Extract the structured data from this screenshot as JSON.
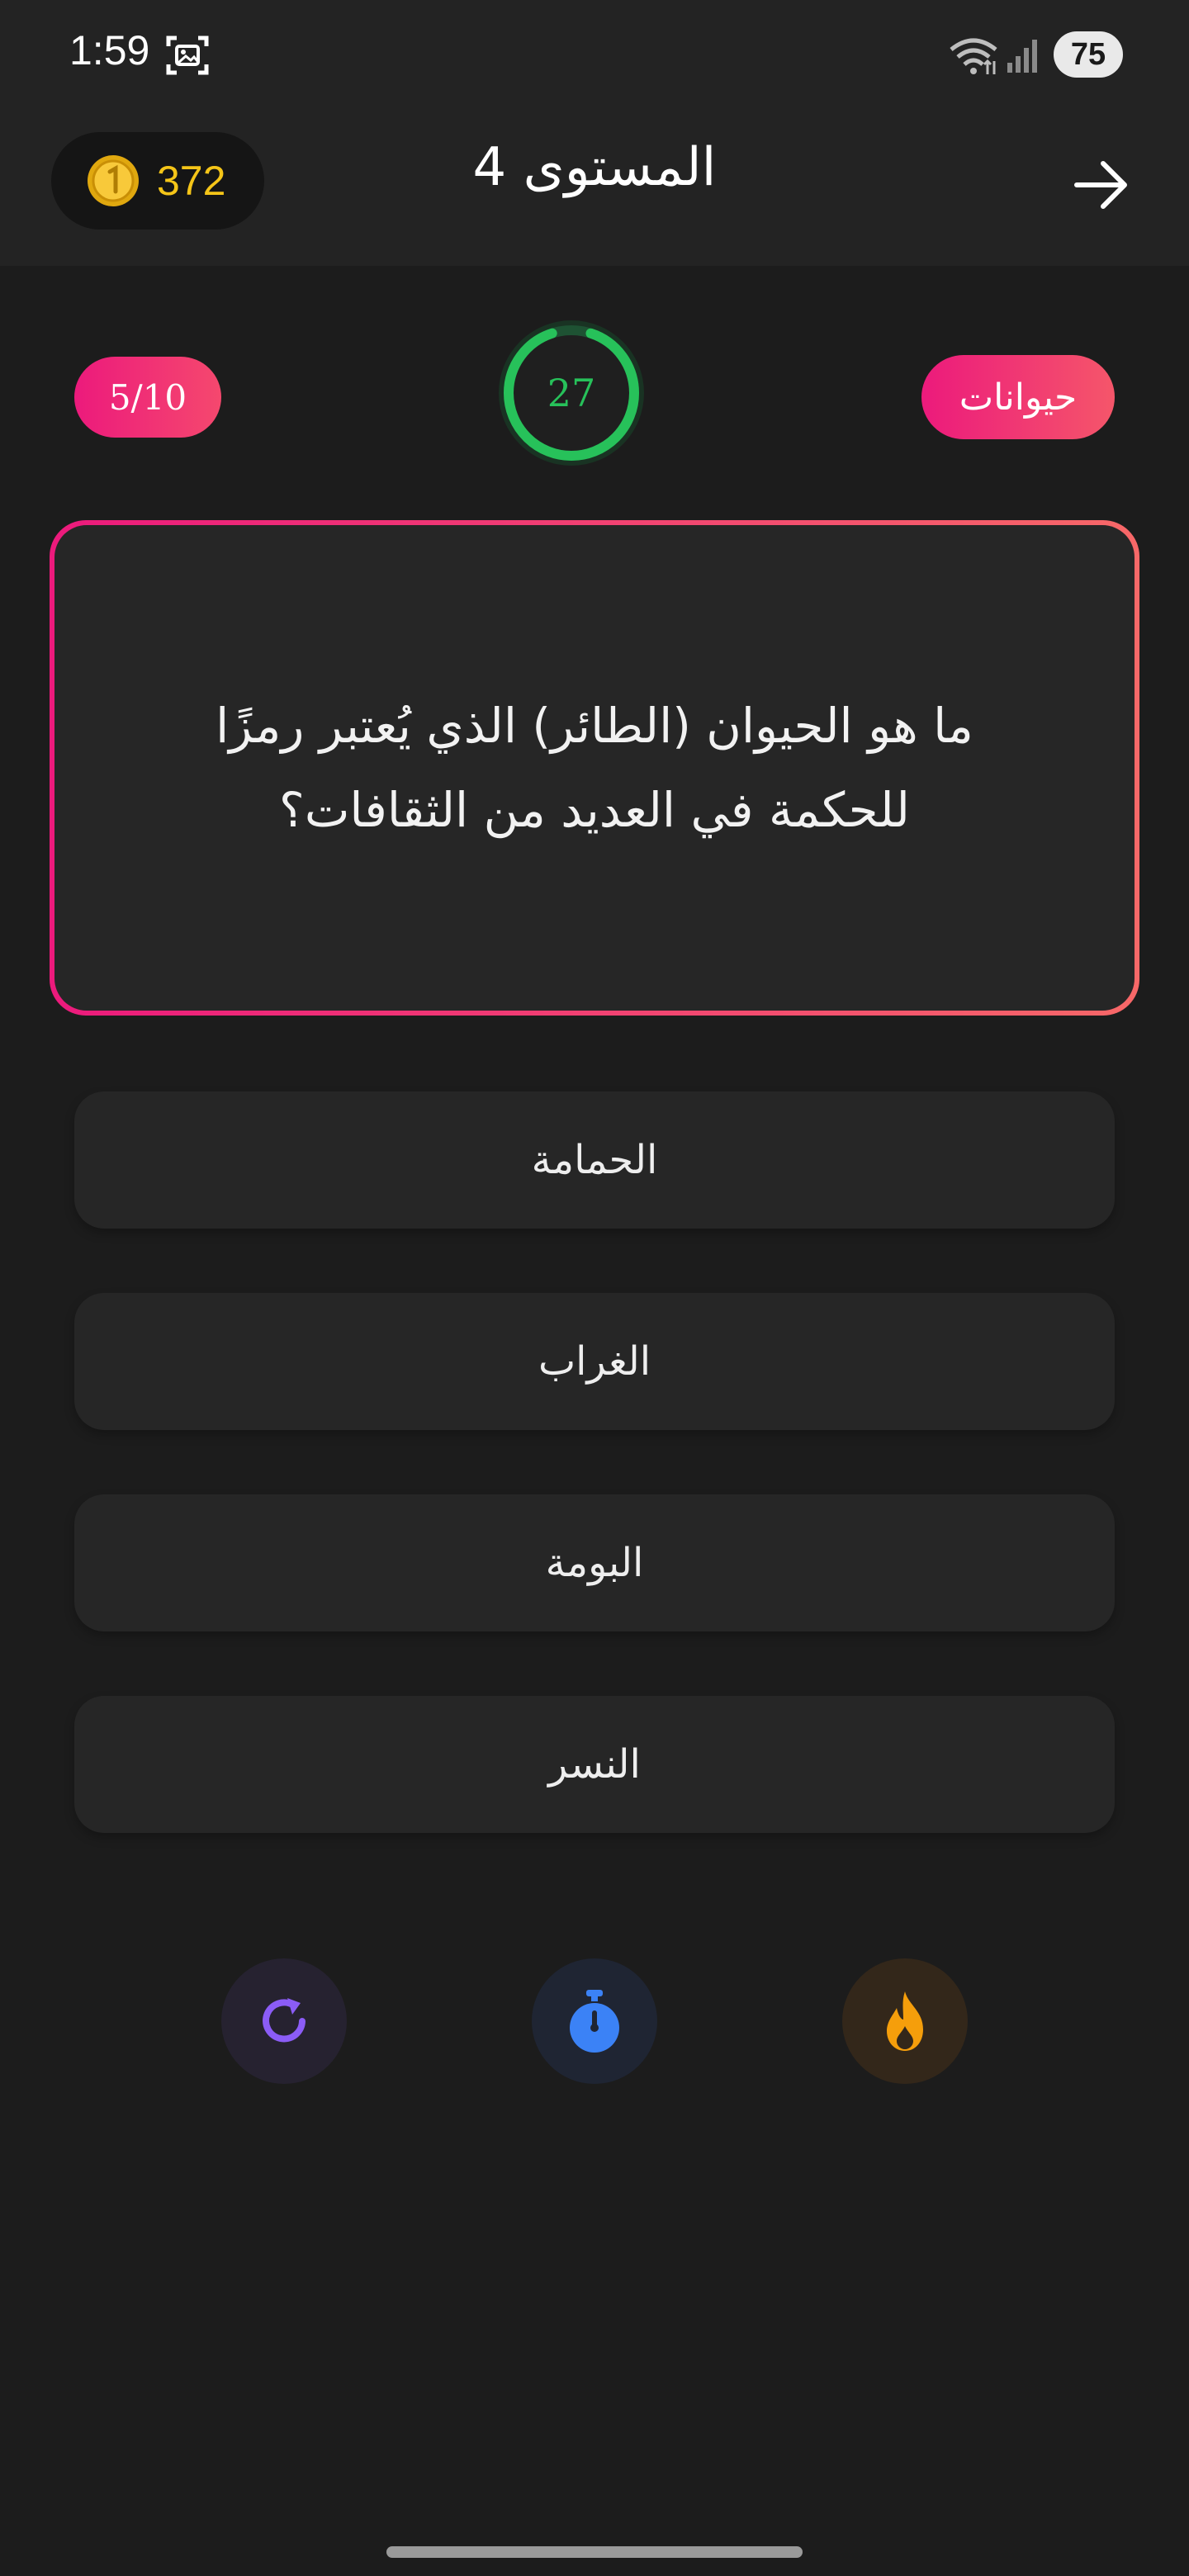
{
  "status_bar": {
    "time": "1:59",
    "battery": "75"
  },
  "header": {
    "coins": "372",
    "level_title": "المستوى 4"
  },
  "quiz": {
    "progress": "5/10",
    "category": "حيوانات",
    "timer_seconds": "27",
    "timer_fraction_remaining": 0.9,
    "question": "ما هو الحيوان (الطائر) الذي يُعتبر رمزًا للحكمة في العديد من الثقافات؟"
  },
  "answers": [
    {
      "label": "الحمامة"
    },
    {
      "label": "الغراب"
    },
    {
      "label": "البومة"
    },
    {
      "label": "النسر"
    }
  ],
  "powerups": [
    {
      "icon": "refresh-icon",
      "color": "#8b5cf6"
    },
    {
      "icon": "stopwatch-icon",
      "color": "#3b82f6"
    },
    {
      "icon": "fire-icon",
      "color": "#f59e0b"
    }
  ],
  "colors": {
    "accent_pink": "#ec1a7c",
    "accent_coral": "#f76868",
    "timer_green": "#27c15a",
    "coin_gold": "#f5c518"
  }
}
